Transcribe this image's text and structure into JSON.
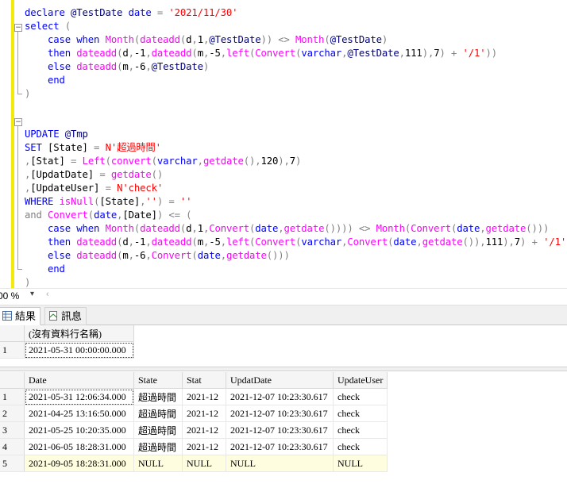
{
  "editor": {
    "lines": [
      [
        [
          "declare ",
          "kw"
        ],
        [
          "@TestDate ",
          "var"
        ],
        [
          "date ",
          "kw"
        ],
        [
          "= ",
          "op"
        ],
        [
          "'2021/11/30'",
          "str"
        ]
      ],
      [
        [
          "select ",
          "kw"
        ],
        [
          "(",
          "op"
        ]
      ],
      [
        [
          "    case ",
          "kw"
        ],
        [
          "when ",
          "kw"
        ],
        [
          "Month",
          "fn"
        ],
        [
          "(",
          "op"
        ],
        [
          "dateadd",
          "fn"
        ],
        [
          "(",
          "op"
        ],
        [
          "d",
          "txt"
        ],
        [
          ",",
          "op"
        ],
        [
          "1",
          "txt"
        ],
        [
          ",",
          "op"
        ],
        [
          "@TestDate",
          "var"
        ],
        [
          ")) ",
          "op"
        ],
        [
          "<> ",
          "op"
        ],
        [
          "Month",
          "fn"
        ],
        [
          "(",
          "op"
        ],
        [
          "@TestDate",
          "var"
        ],
        [
          ")",
          "op"
        ]
      ],
      [
        [
          "    then ",
          "kw"
        ],
        [
          "dateadd",
          "fn"
        ],
        [
          "(",
          "op"
        ],
        [
          "d",
          "txt"
        ],
        [
          ",",
          "op"
        ],
        [
          "-1",
          "txt"
        ],
        [
          ",",
          "op"
        ],
        [
          "dateadd",
          "fn"
        ],
        [
          "(",
          "op"
        ],
        [
          "m",
          "txt"
        ],
        [
          ",",
          "op"
        ],
        [
          "-5",
          "txt"
        ],
        [
          ",",
          "op"
        ],
        [
          "left",
          "fn"
        ],
        [
          "(",
          "op"
        ],
        [
          "Convert",
          "fn"
        ],
        [
          "(",
          "op"
        ],
        [
          "varchar",
          "kw"
        ],
        [
          ",",
          "op"
        ],
        [
          "@TestDate",
          "var"
        ],
        [
          ",",
          "op"
        ],
        [
          "111",
          "txt"
        ],
        [
          "),",
          "op"
        ],
        [
          "7",
          "txt"
        ],
        [
          ") ",
          "op"
        ],
        [
          "+ ",
          "op"
        ],
        [
          "'/1'",
          "str"
        ],
        [
          "))",
          "op"
        ]
      ],
      [
        [
          "    else ",
          "kw"
        ],
        [
          "dateadd",
          "fn"
        ],
        [
          "(",
          "op"
        ],
        [
          "m",
          "txt"
        ],
        [
          ",",
          "op"
        ],
        [
          "-6",
          "txt"
        ],
        [
          ",",
          "op"
        ],
        [
          "@TestDate",
          "var"
        ],
        [
          ")",
          "op"
        ]
      ],
      [
        [
          "    end",
          "kw"
        ]
      ],
      [
        [
          ")",
          "op"
        ]
      ],
      [],
      [],
      [
        [
          "UPDATE ",
          "kw"
        ],
        [
          "@Tmp",
          "var"
        ]
      ],
      [
        [
          "SET ",
          "kw"
        ],
        [
          "[State] ",
          "txt"
        ],
        [
          "= ",
          "op"
        ],
        [
          "N'超過時間'",
          "str"
        ]
      ],
      [
        [
          ",",
          "op"
        ],
        [
          "[Stat] ",
          "txt"
        ],
        [
          "= ",
          "op"
        ],
        [
          "Left",
          "fn"
        ],
        [
          "(",
          "op"
        ],
        [
          "convert",
          "fn"
        ],
        [
          "(",
          "op"
        ],
        [
          "varchar",
          "kw"
        ],
        [
          ",",
          "op"
        ],
        [
          "getdate",
          "fn"
        ],
        [
          "(),",
          "op"
        ],
        [
          "120",
          "txt"
        ],
        [
          "),",
          "op"
        ],
        [
          "7",
          "txt"
        ],
        [
          ")",
          "op"
        ]
      ],
      [
        [
          ",",
          "op"
        ],
        [
          "[UpdatDate] ",
          "txt"
        ],
        [
          "= ",
          "op"
        ],
        [
          "getdate",
          "fn"
        ],
        [
          "()",
          "op"
        ]
      ],
      [
        [
          ",",
          "op"
        ],
        [
          "[UpdateUser] ",
          "txt"
        ],
        [
          "= ",
          "op"
        ],
        [
          "N'check'",
          "str"
        ]
      ],
      [
        [
          "WHERE ",
          "kw"
        ],
        [
          "isNull",
          "fn"
        ],
        [
          "(",
          "op"
        ],
        [
          "[State]",
          "txt"
        ],
        [
          ",",
          "op"
        ],
        [
          "''",
          "str"
        ],
        [
          ") ",
          "op"
        ],
        [
          "= ",
          "op"
        ],
        [
          "''",
          "str"
        ]
      ],
      [
        [
          "and ",
          "op"
        ],
        [
          "Convert",
          "fn"
        ],
        [
          "(",
          "op"
        ],
        [
          "date",
          "kw"
        ],
        [
          ",",
          "op"
        ],
        [
          "[Date]",
          "txt"
        ],
        [
          ") ",
          "op"
        ],
        [
          "<= ",
          "op"
        ],
        [
          "(",
          "op"
        ]
      ],
      [
        [
          "    case ",
          "kw"
        ],
        [
          "when ",
          "kw"
        ],
        [
          "Month",
          "fn"
        ],
        [
          "(",
          "op"
        ],
        [
          "dateadd",
          "fn"
        ],
        [
          "(",
          "op"
        ],
        [
          "d",
          "txt"
        ],
        [
          ",",
          "op"
        ],
        [
          "1",
          "txt"
        ],
        [
          ",",
          "op"
        ],
        [
          "Convert",
          "fn"
        ],
        [
          "(",
          "op"
        ],
        [
          "date",
          "kw"
        ],
        [
          ",",
          "op"
        ],
        [
          "getdate",
          "fn"
        ],
        [
          "()))) ",
          "op"
        ],
        [
          "<> ",
          "op"
        ],
        [
          "Month",
          "fn"
        ],
        [
          "(",
          "op"
        ],
        [
          "Convert",
          "fn"
        ],
        [
          "(",
          "op"
        ],
        [
          "date",
          "kw"
        ],
        [
          ",",
          "op"
        ],
        [
          "getdate",
          "fn"
        ],
        [
          "()))",
          "op"
        ]
      ],
      [
        [
          "    then ",
          "kw"
        ],
        [
          "dateadd",
          "fn"
        ],
        [
          "(",
          "op"
        ],
        [
          "d",
          "txt"
        ],
        [
          ",",
          "op"
        ],
        [
          "-1",
          "txt"
        ],
        [
          ",",
          "op"
        ],
        [
          "dateadd",
          "fn"
        ],
        [
          "(",
          "op"
        ],
        [
          "m",
          "txt"
        ],
        [
          ",",
          "op"
        ],
        [
          "-5",
          "txt"
        ],
        [
          ",",
          "op"
        ],
        [
          "left",
          "fn"
        ],
        [
          "(",
          "op"
        ],
        [
          "Convert",
          "fn"
        ],
        [
          "(",
          "op"
        ],
        [
          "varchar",
          "kw"
        ],
        [
          ",",
          "op"
        ],
        [
          "Convert",
          "fn"
        ],
        [
          "(",
          "op"
        ],
        [
          "date",
          "kw"
        ],
        [
          ",",
          "op"
        ],
        [
          "getdate",
          "fn"
        ],
        [
          "()),",
          "op"
        ],
        [
          "111",
          "txt"
        ],
        [
          "),",
          "op"
        ],
        [
          "7",
          "txt"
        ],
        [
          ") ",
          "op"
        ],
        [
          "+ ",
          "op"
        ],
        [
          "'/1'",
          "str"
        ],
        [
          "))",
          "op"
        ]
      ],
      [
        [
          "    else ",
          "kw"
        ],
        [
          "dateadd",
          "fn"
        ],
        [
          "(",
          "op"
        ],
        [
          "m",
          "txt"
        ],
        [
          ",",
          "op"
        ],
        [
          "-6",
          "txt"
        ],
        [
          ",",
          "op"
        ],
        [
          "Convert",
          "fn"
        ],
        [
          "(",
          "op"
        ],
        [
          "date",
          "kw"
        ],
        [
          ",",
          "op"
        ],
        [
          "getdate",
          "fn"
        ],
        [
          "()))",
          "op"
        ]
      ],
      [
        [
          "    end",
          "kw"
        ]
      ],
      [
        [
          ")",
          "op"
        ]
      ]
    ]
  },
  "zoom": {
    "value": "00 %",
    "dropdown_icon": "chevron-down-icon",
    "scroll_left_icon": "chevron-left-icon"
  },
  "tabs": {
    "results": "結果",
    "messages": "訊息"
  },
  "grid1": {
    "header": "(沒有資料行名稱)",
    "rows": [
      [
        "1",
        "2021-05-31 00:00:00.000"
      ]
    ]
  },
  "grid2": {
    "headers": [
      "Date",
      "State",
      "Stat",
      "UpdatDate",
      "UpdateUser"
    ],
    "rows": [
      [
        "1",
        "2021-05-31 12:06:34.000",
        "超過時間",
        "2021-12",
        "2021-12-07 10:23:30.617",
        "check"
      ],
      [
        "2",
        "2021-04-25 13:16:50.000",
        "超過時間",
        "2021-12",
        "2021-12-07 10:23:30.617",
        "check"
      ],
      [
        "3",
        "2021-05-25 10:20:35.000",
        "超過時間",
        "2021-12",
        "2021-12-07 10:23:30.617",
        "check"
      ],
      [
        "4",
        "2021-06-05 18:28:31.000",
        "超過時間",
        "2021-12",
        "2021-12-07 10:23:30.617",
        "check"
      ],
      [
        "5",
        "2021-09-05 18:28:31.000",
        "NULL",
        "NULL",
        "NULL",
        "NULL"
      ]
    ]
  }
}
